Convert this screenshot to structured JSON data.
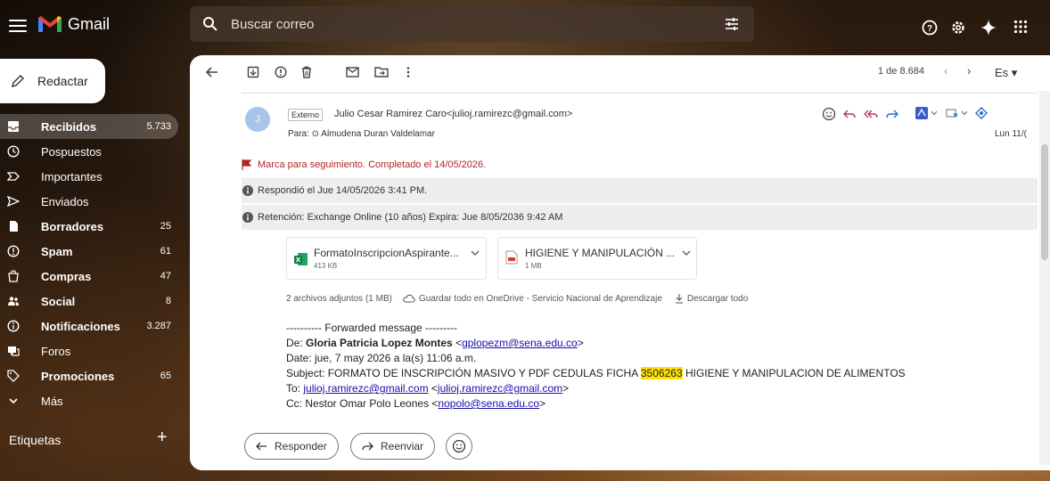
{
  "app": {
    "name": "Gmail"
  },
  "search": {
    "placeholder": "Buscar correo"
  },
  "compose": {
    "label": "Redactar"
  },
  "nav": [
    {
      "label": "Recibidos",
      "count": "5.733",
      "bold": true,
      "active": true,
      "icon": "inbox-icon"
    },
    {
      "label": "Pospuestos",
      "count": "",
      "bold": false,
      "active": false,
      "icon": "clock-icon"
    },
    {
      "label": "Importantes",
      "count": "",
      "bold": false,
      "active": false,
      "icon": "important-icon"
    },
    {
      "label": "Enviados",
      "count": "",
      "bold": false,
      "active": false,
      "icon": "send-icon"
    },
    {
      "label": "Borradores",
      "count": "25",
      "bold": true,
      "active": false,
      "icon": "draft-icon"
    },
    {
      "label": "Spam",
      "count": "61",
      "bold": true,
      "active": false,
      "icon": "spam-icon"
    },
    {
      "label": "Compras",
      "count": "47",
      "bold": true,
      "active": false,
      "icon": "shopping-icon"
    },
    {
      "label": "Social",
      "count": "8",
      "bold": true,
      "active": false,
      "icon": "people-icon"
    },
    {
      "label": "Notificaciones",
      "count": "3.287",
      "bold": true,
      "active": false,
      "icon": "info-icon"
    },
    {
      "label": "Foros",
      "count": "",
      "bold": false,
      "active": false,
      "icon": "forum-icon"
    },
    {
      "label": "Promociones",
      "count": "65",
      "bold": true,
      "active": false,
      "icon": "tag-icon"
    },
    {
      "label": "Más",
      "count": "",
      "bold": false,
      "active": false,
      "icon": "chevron-down-icon"
    }
  ],
  "labels": {
    "header": "Etiquetas",
    "add": "+"
  },
  "toolbar": {
    "pager": "1 de 8.684",
    "lang": "Es ▾"
  },
  "email": {
    "avatar_letter": "J",
    "external_badge": "Externo",
    "sender": "Julio Cesar Ramirez Caro<julioj.ramirezc@gmail.com>",
    "to": "Para: ⊙ Almudena Duran Valdelamar",
    "date": "Lun 11/(",
    "flag_text": "Marca para seguimiento. Completado el 14/05/2026.",
    "info1": "Respondió el Jue 14/05/2026 3:41 PM.",
    "info2": "Retención: Exchange Online (10 años) Expira: Jue 8/05/2036 9:42 AM",
    "attachments": [
      {
        "name": "FormatoInscripcionAspirante...",
        "size": "413 KB",
        "icon": "excel-icon"
      },
      {
        "name": "HIGIENE Y MANIPULACIÓN ...",
        "size": "1 MB",
        "icon": "pdf-icon"
      }
    ],
    "att_summary": "2 archivos adjuntos (1 MB)",
    "save_onedrive": "Guardar todo en OneDrive - Servicio Nacional de Aprendizaje",
    "download_all": "Descargar todo",
    "body": {
      "fwd": "---------- Forwarded message ---------",
      "from_label": "De:",
      "from_name": "Gloria Patricia Lopez Montes",
      "from_email": "gplopezm@sena.edu.co",
      "date_line": "Date: jue, 7 may 2026 a la(s) 11:06 a.m.",
      "subject_pre": "Subject: FORMATO DE INSCRIPCIÓN MASIVO Y PDF CEDULAS FICHA",
      "subject_hl": "3506263",
      "subject_post": "HIGIENE Y MANIPULACION DE ALIMENTOS",
      "to_label": "To:",
      "to_email": "julioj.ramirezc@gmail.com",
      "to_email2": "julioj.ramirezc@gmail.com",
      "cc_pre": "Cc: Nestor Omar Polo Leones",
      "cc_email": "nopolo@sena.edu.co"
    }
  },
  "reply": {
    "reply_label": "Responder",
    "forward_label": "Reenviar"
  }
}
